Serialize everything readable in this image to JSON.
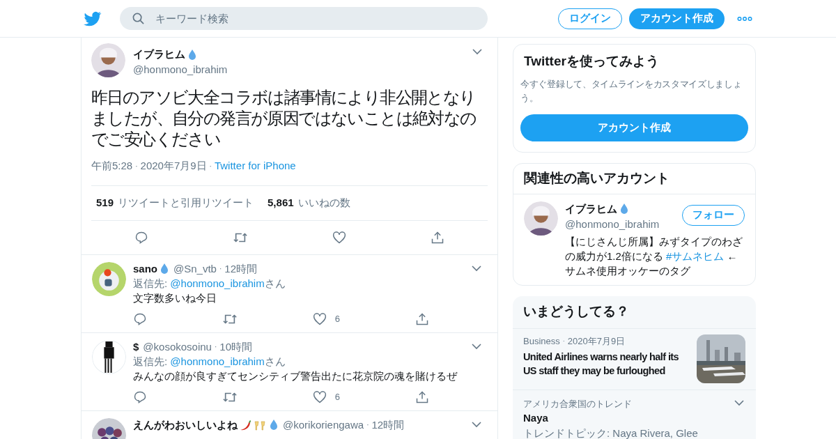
{
  "header": {
    "search": {
      "placeholder": "キーワード検索"
    },
    "login": "ログイン",
    "signup": "アカウント作成"
  },
  "tweet": {
    "avatar": {
      "kind": "portrait"
    },
    "name": "イブラヒム",
    "badges": [
      {
        "kind": "drop"
      }
    ],
    "separator": "·",
    "handle": "@honmono_ibrahim",
    "text": "昨日のアソビ大全コラボは諸事情により非公開となりましたが、自分の発言が原因ではないことは絶対なのでご安心ください",
    "time": "午前5:28",
    "date": "2020年7月9日",
    "source": "Twitter for iPhone",
    "retweets": "519",
    "retweets_label": "リツイートと引用リツイート",
    "likes": "5,861",
    "likes_label": "いいねの数"
  },
  "replies": [
    {
      "avatar": {
        "kind": "bird"
      },
      "name": "sano",
      "badges": [
        {
          "kind": "drop"
        }
      ],
      "handle": "@Sn_vtb",
      "separator": "·",
      "time": "12時間",
      "reply_prefix": "返信先:",
      "reply_to": "@honmono_ibrahim",
      "reply_suffix": "さん",
      "text": "文字数多いね今日",
      "likes": "6"
    },
    {
      "avatar": {
        "kind": "figure"
      },
      "name": "$",
      "handle": "@kosokosoinu",
      "separator": "·",
      "time": "10時間",
      "reply_prefix": "返信先:",
      "reply_to": "@honmono_ibrahim",
      "reply_suffix": "さん",
      "text": "みんなの顔が良すぎてセンシティブ警告出たに花京院の魂を賭けるぜ",
      "likes": "6"
    },
    {
      "avatar": {
        "kind": "balls"
      },
      "name": "えんがわおいしいよね",
      "badges": [
        {
          "kind": "chili"
        },
        {
          "kind": "cheers"
        },
        {
          "kind": "drop"
        }
      ],
      "handle": "@korikoriengawa",
      "separator": "·",
      "time": "12時間"
    }
  ],
  "signup_card": {
    "title": "Twitterを使ってみよう",
    "text": "今すぐ登録して、タイムラインをカスタマイズしましょう。",
    "button": "アカウント作成"
  },
  "related": {
    "title": "関連性の高いアカウント",
    "accounts": [
      {
        "avatar": {
          "kind": "portrait"
        },
        "name": "イブラヒム",
        "badges": [
          {
            "kind": "drop"
          }
        ],
        "handle": "@honmono_ibrahim",
        "follow": "フォロー",
        "bio_before": "【にじさんじ所属】みずタイプのわざの威力が1.2倍になる",
        "hashtag": "#サムネヒム",
        "bio_after": "← サムネ使用オッケーのタグ"
      }
    ]
  },
  "trends": {
    "title": "いまどうしてる？",
    "items": [
      {
        "kind": "news",
        "category": "Business",
        "separator": "·",
        "date": "2020年7月9日",
        "headline": "United Airlines warns nearly half its US staff they may be furloughed"
      },
      {
        "kind": "trend",
        "category": "アメリカ合衆国のトレンド",
        "topic": "Naya",
        "detail": "トレンドトピック: Naya Rivera, Glee"
      }
    ]
  }
}
